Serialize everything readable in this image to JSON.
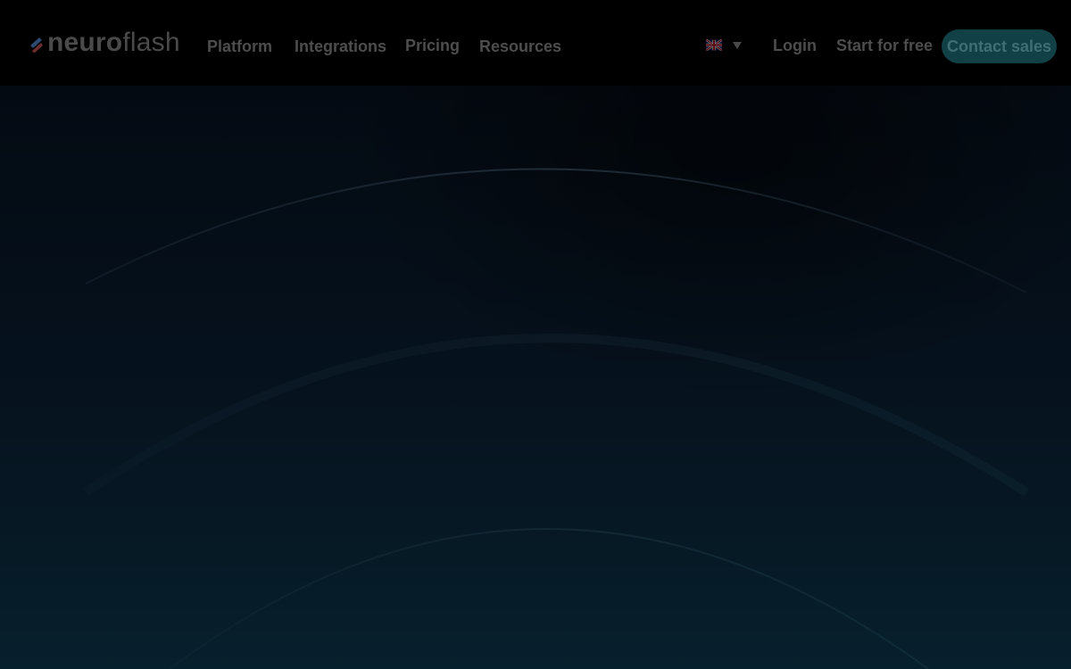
{
  "header": {
    "logo": {
      "text_bold": "neuro",
      "text_light": "flash",
      "mark_colors": [
        "#2b4a6e",
        "#6b2d2d"
      ]
    },
    "nav": [
      {
        "label": "Platform"
      },
      {
        "label": "Integrations"
      },
      {
        "label": "Pricing"
      },
      {
        "label": "Resources"
      }
    ],
    "language": {
      "icon": "uk-flag-icon",
      "dropdown_icon": "chevron-down-icon"
    },
    "login_label": "Login",
    "start_label": "Start for free",
    "contact_label": "Contact sales"
  },
  "colors": {
    "background": "#000000",
    "accent": "#124047",
    "nav_text": "#4d4d4d"
  }
}
